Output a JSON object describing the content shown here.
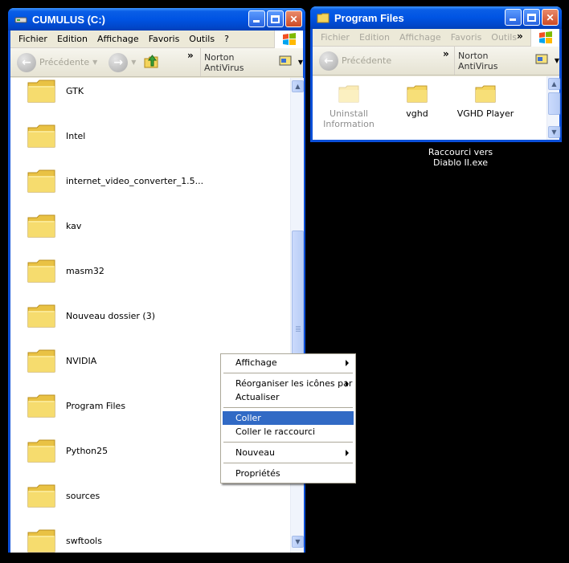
{
  "cumulus": {
    "title": "CUMULUS (C:)",
    "menu": [
      "Fichier",
      "Edition",
      "Affichage",
      "Favoris",
      "Outils",
      "?"
    ],
    "back_label": "Précédente",
    "chevron": "»",
    "norton_label": "Norton AntiVirus",
    "folders": [
      "GTK",
      "Intel",
      "internet_video_converter_1.5...",
      "kav",
      "masm32",
      "Nouveau dossier (3)",
      "NVIDIA",
      "Program Files",
      "Python25",
      "sources",
      "swftools"
    ]
  },
  "program_files": {
    "title": "Program Files",
    "menu": [
      "Fichier",
      "Edition",
      "Affichage",
      "Favoris",
      "Outils"
    ],
    "back_label": "Précédente",
    "chevron": "»",
    "norton_label": "Norton AntiVirus",
    "items": [
      {
        "label": "Uninstall Information",
        "hidden": true
      },
      {
        "label": "vghd",
        "hidden": false
      },
      {
        "label": "VGHD Player",
        "hidden": false
      }
    ]
  },
  "desktop": {
    "shortcut_label_line1": "Raccourci vers",
    "shortcut_label_line2": "Diablo II.exe"
  },
  "context_menu": {
    "items": [
      {
        "label": "Affichage",
        "submenu": true,
        "highlighted": false
      },
      {
        "sep": true
      },
      {
        "label": "Réorganiser les icônes par",
        "submenu": true,
        "highlighted": false
      },
      {
        "label": "Actualiser",
        "submenu": false,
        "highlighted": false
      },
      {
        "sep": true
      },
      {
        "label": "Coller",
        "submenu": false,
        "highlighted": true
      },
      {
        "label": "Coller le raccourci",
        "submenu": false,
        "highlighted": false
      },
      {
        "sep": true
      },
      {
        "label": "Nouveau",
        "submenu": true,
        "highlighted": false
      },
      {
        "sep": true
      },
      {
        "label": "Propriétés",
        "submenu": false,
        "highlighted": false
      }
    ]
  },
  "colors": {
    "title_bar": "#0054e3",
    "selection": "#316ac5",
    "folder": "#f4d45c"
  }
}
